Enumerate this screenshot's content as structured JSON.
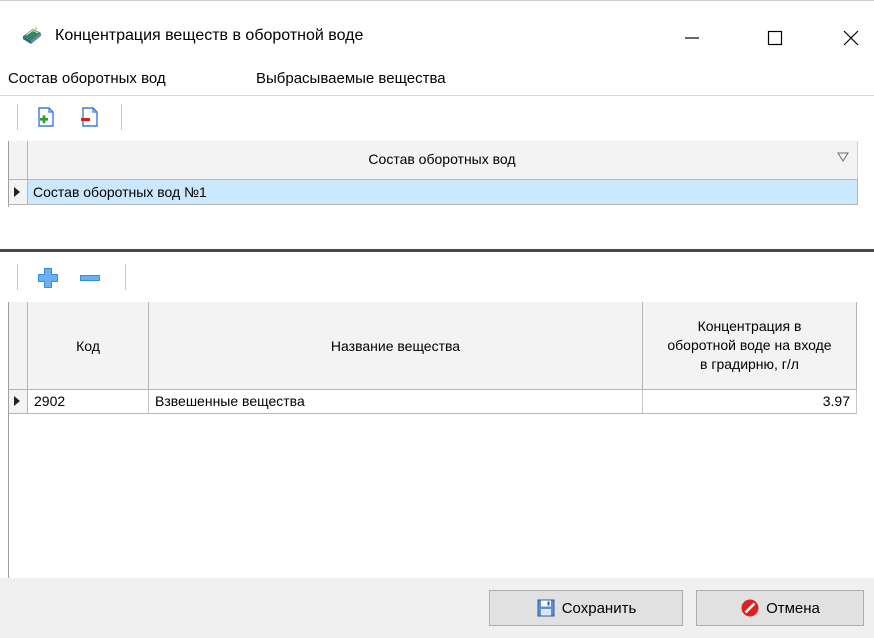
{
  "window": {
    "title": "Концентрация веществ в оборотной воде",
    "icon": "book-icon"
  },
  "menu": {
    "items": [
      {
        "label": "Состав оборотных вод"
      },
      {
        "label": "Выбрасываемые вещества"
      }
    ]
  },
  "toolbar1": {
    "buttons": [
      {
        "icon": "add-document-icon"
      },
      {
        "icon": "remove-document-icon"
      }
    ]
  },
  "grid1": {
    "header": "Состав оборотных вод",
    "rows": [
      "Состав оборотных вод №1"
    ]
  },
  "toolbar2": {
    "buttons": [
      {
        "icon": "plus-icon"
      },
      {
        "icon": "minus-icon"
      }
    ]
  },
  "grid2": {
    "columns": {
      "code": "Код",
      "name": "Название вещества",
      "concentration": "Концентрация в оборотной воде на входе в градирню, г/л"
    },
    "rows": [
      {
        "code": "2902",
        "name": "Взвешенные вещества",
        "concentration": "3.97"
      }
    ]
  },
  "footer": {
    "save_label": "Сохранить",
    "cancel_label": "Отмена"
  },
  "colors": {
    "selected_row": "#cce8ff",
    "header_bg": "#f3f3f3",
    "footer_bg": "#f0f0f0",
    "accent_blue": "#3c8fe0",
    "cancel_red": "#e02020"
  }
}
